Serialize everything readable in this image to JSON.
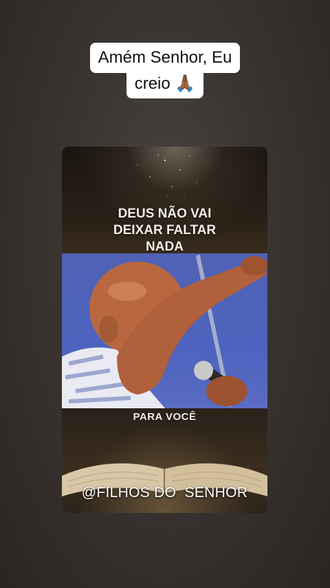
{
  "caption": {
    "line1": "Amém Senhor, Eu",
    "line2": "creio 🙏🏾"
  },
  "video": {
    "headline": [
      "DEUS NÃO VAI",
      "DEIXAR FALTAR",
      "NADA"
    ],
    "subline": "PARA VOCÊ",
    "watermark": "@FILHOS DO  SENHOR"
  },
  "colors": {
    "background": "#3a3431",
    "caption_bg": "#ffffff",
    "photo_sky": "#4d63be"
  }
}
